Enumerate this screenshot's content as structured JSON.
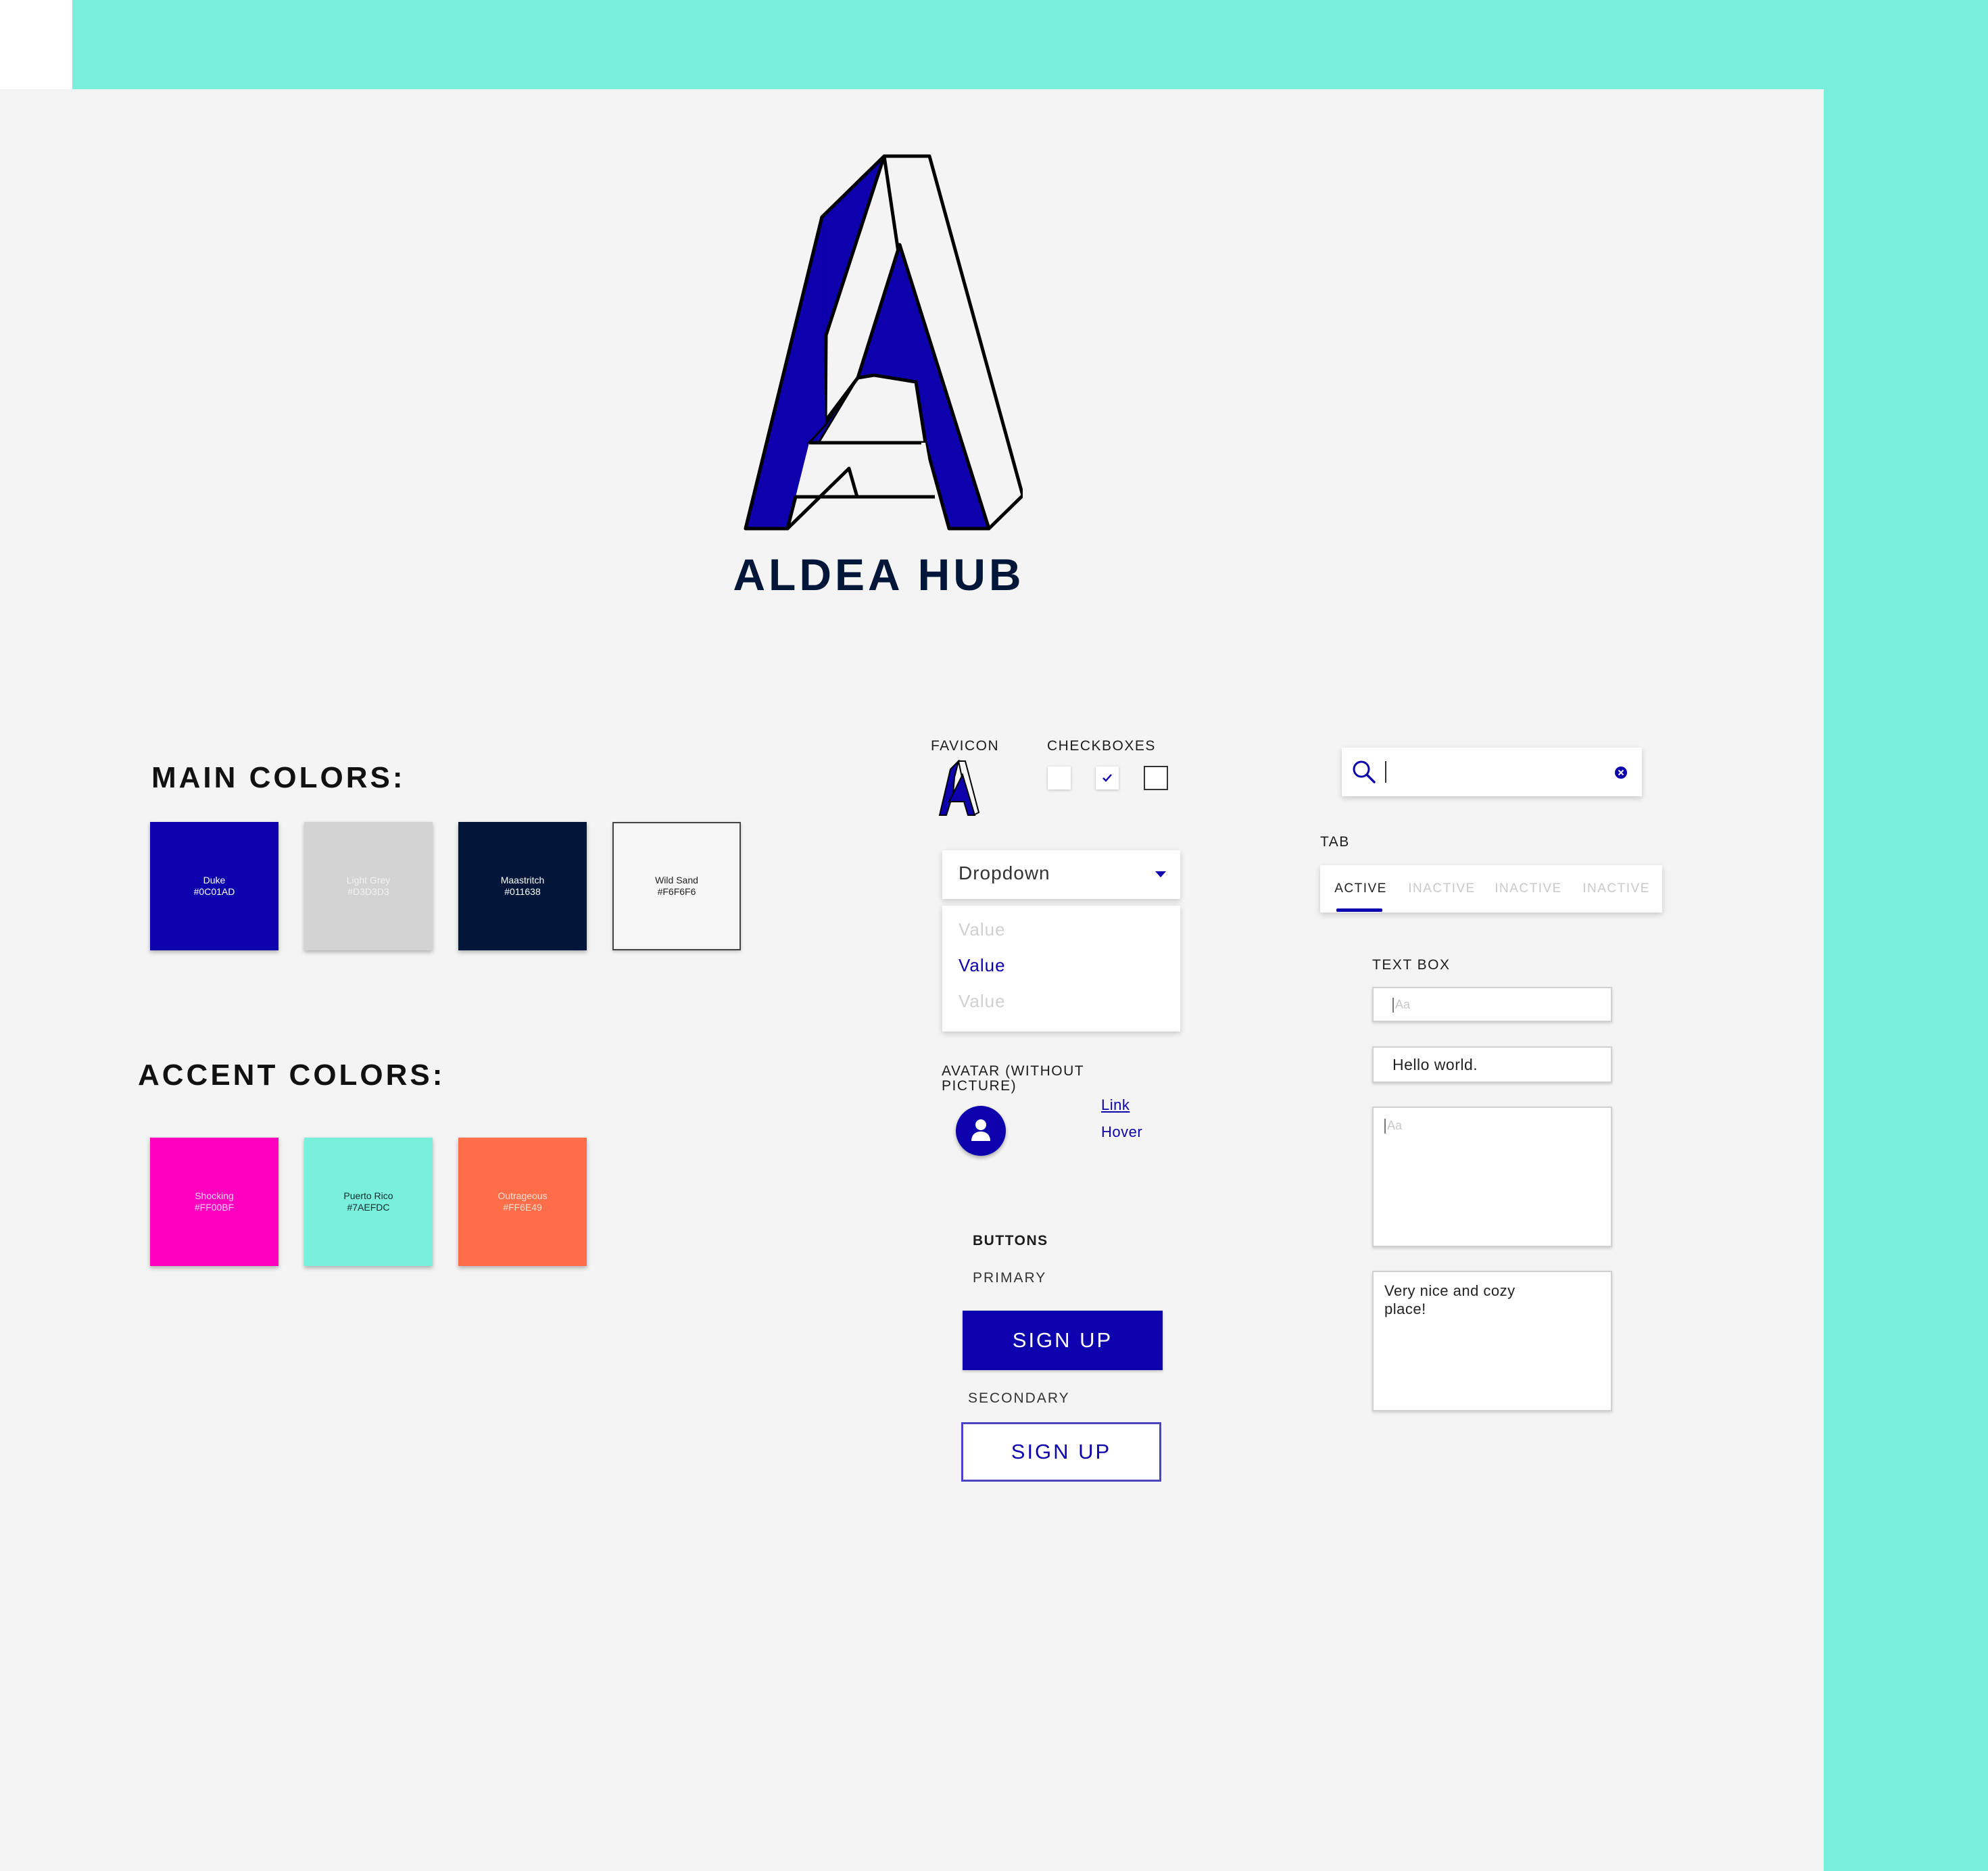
{
  "brand": {
    "name": "ALDEA HUB"
  },
  "main_colors": {
    "title": "MAIN COLORS:",
    "swatches": [
      {
        "name": "Duke",
        "hex": "#0C01AD",
        "text_color": "#ffffff"
      },
      {
        "name": "Light Grey",
        "hex": "#D3D3D3",
        "text_color": "#f2f2f2"
      },
      {
        "name": "Maastritch",
        "hex": "#011638",
        "text_color": "#ffffff"
      },
      {
        "name": "Wild Sand",
        "hex": "#F6F6F6",
        "text_color": "#222222"
      }
    ]
  },
  "accent_colors": {
    "title": "ACCENT COLORS:",
    "swatches": [
      {
        "name": "Shocking",
        "hex": "#FF00BF",
        "text_color": "#ffd6f0"
      },
      {
        "name": "Puerto Rico",
        "hex": "#7AEFDC",
        "text_color": "#0e2a2a"
      },
      {
        "name": "Outrageous",
        "hex": "#FF6E49",
        "text_color": "#ffe0d6"
      }
    ]
  },
  "favicon": {
    "label": "FAVICON",
    "icon": "aldea-a-icon"
  },
  "checkboxes": {
    "label": "CHECKBOXES",
    "items": [
      {
        "state": "unchecked"
      },
      {
        "state": "checked"
      },
      {
        "state": "outlined"
      }
    ]
  },
  "dropdown": {
    "selected": "Dropdown",
    "options": [
      {
        "label": "Value",
        "state": "disabled"
      },
      {
        "label": "Value",
        "state": "active"
      },
      {
        "label": "Value",
        "state": "disabled"
      }
    ]
  },
  "avatar": {
    "label": "AVATAR (WITHOUT PICTURE)",
    "icon": "user-icon"
  },
  "links": {
    "link": "Link",
    "hover": "Hover"
  },
  "buttons": {
    "label": "BUTTONS",
    "primary_label": "PRIMARY",
    "primary_text": "SIGN UP",
    "secondary_label": "SECONDARY",
    "secondary_text": "SIGN UP"
  },
  "search": {
    "icon": "search-icon",
    "clear_icon": "clear-icon"
  },
  "tabs": {
    "label": "TAB",
    "items": [
      {
        "label": "ACTIVE",
        "state": "active"
      },
      {
        "label": "INACTIVE",
        "state": "inactive"
      },
      {
        "label": "INACTIVE",
        "state": "inactive"
      },
      {
        "label": "INACTIVE",
        "state": "inactive"
      }
    ]
  },
  "text_box": {
    "label": "TEXT BOX",
    "placeholder": "Aa",
    "filled_value": "Hello world.",
    "area_placeholder": "Aa",
    "area_value_line1": "Very nice and cozy",
    "area_value_line2": "place!"
  },
  "colors": {
    "primary": "#0C01AD",
    "navy": "#011638",
    "teal": "#7AEFDC",
    "board": "#F4F4F4",
    "inactive_text": "#c9c9c9"
  }
}
